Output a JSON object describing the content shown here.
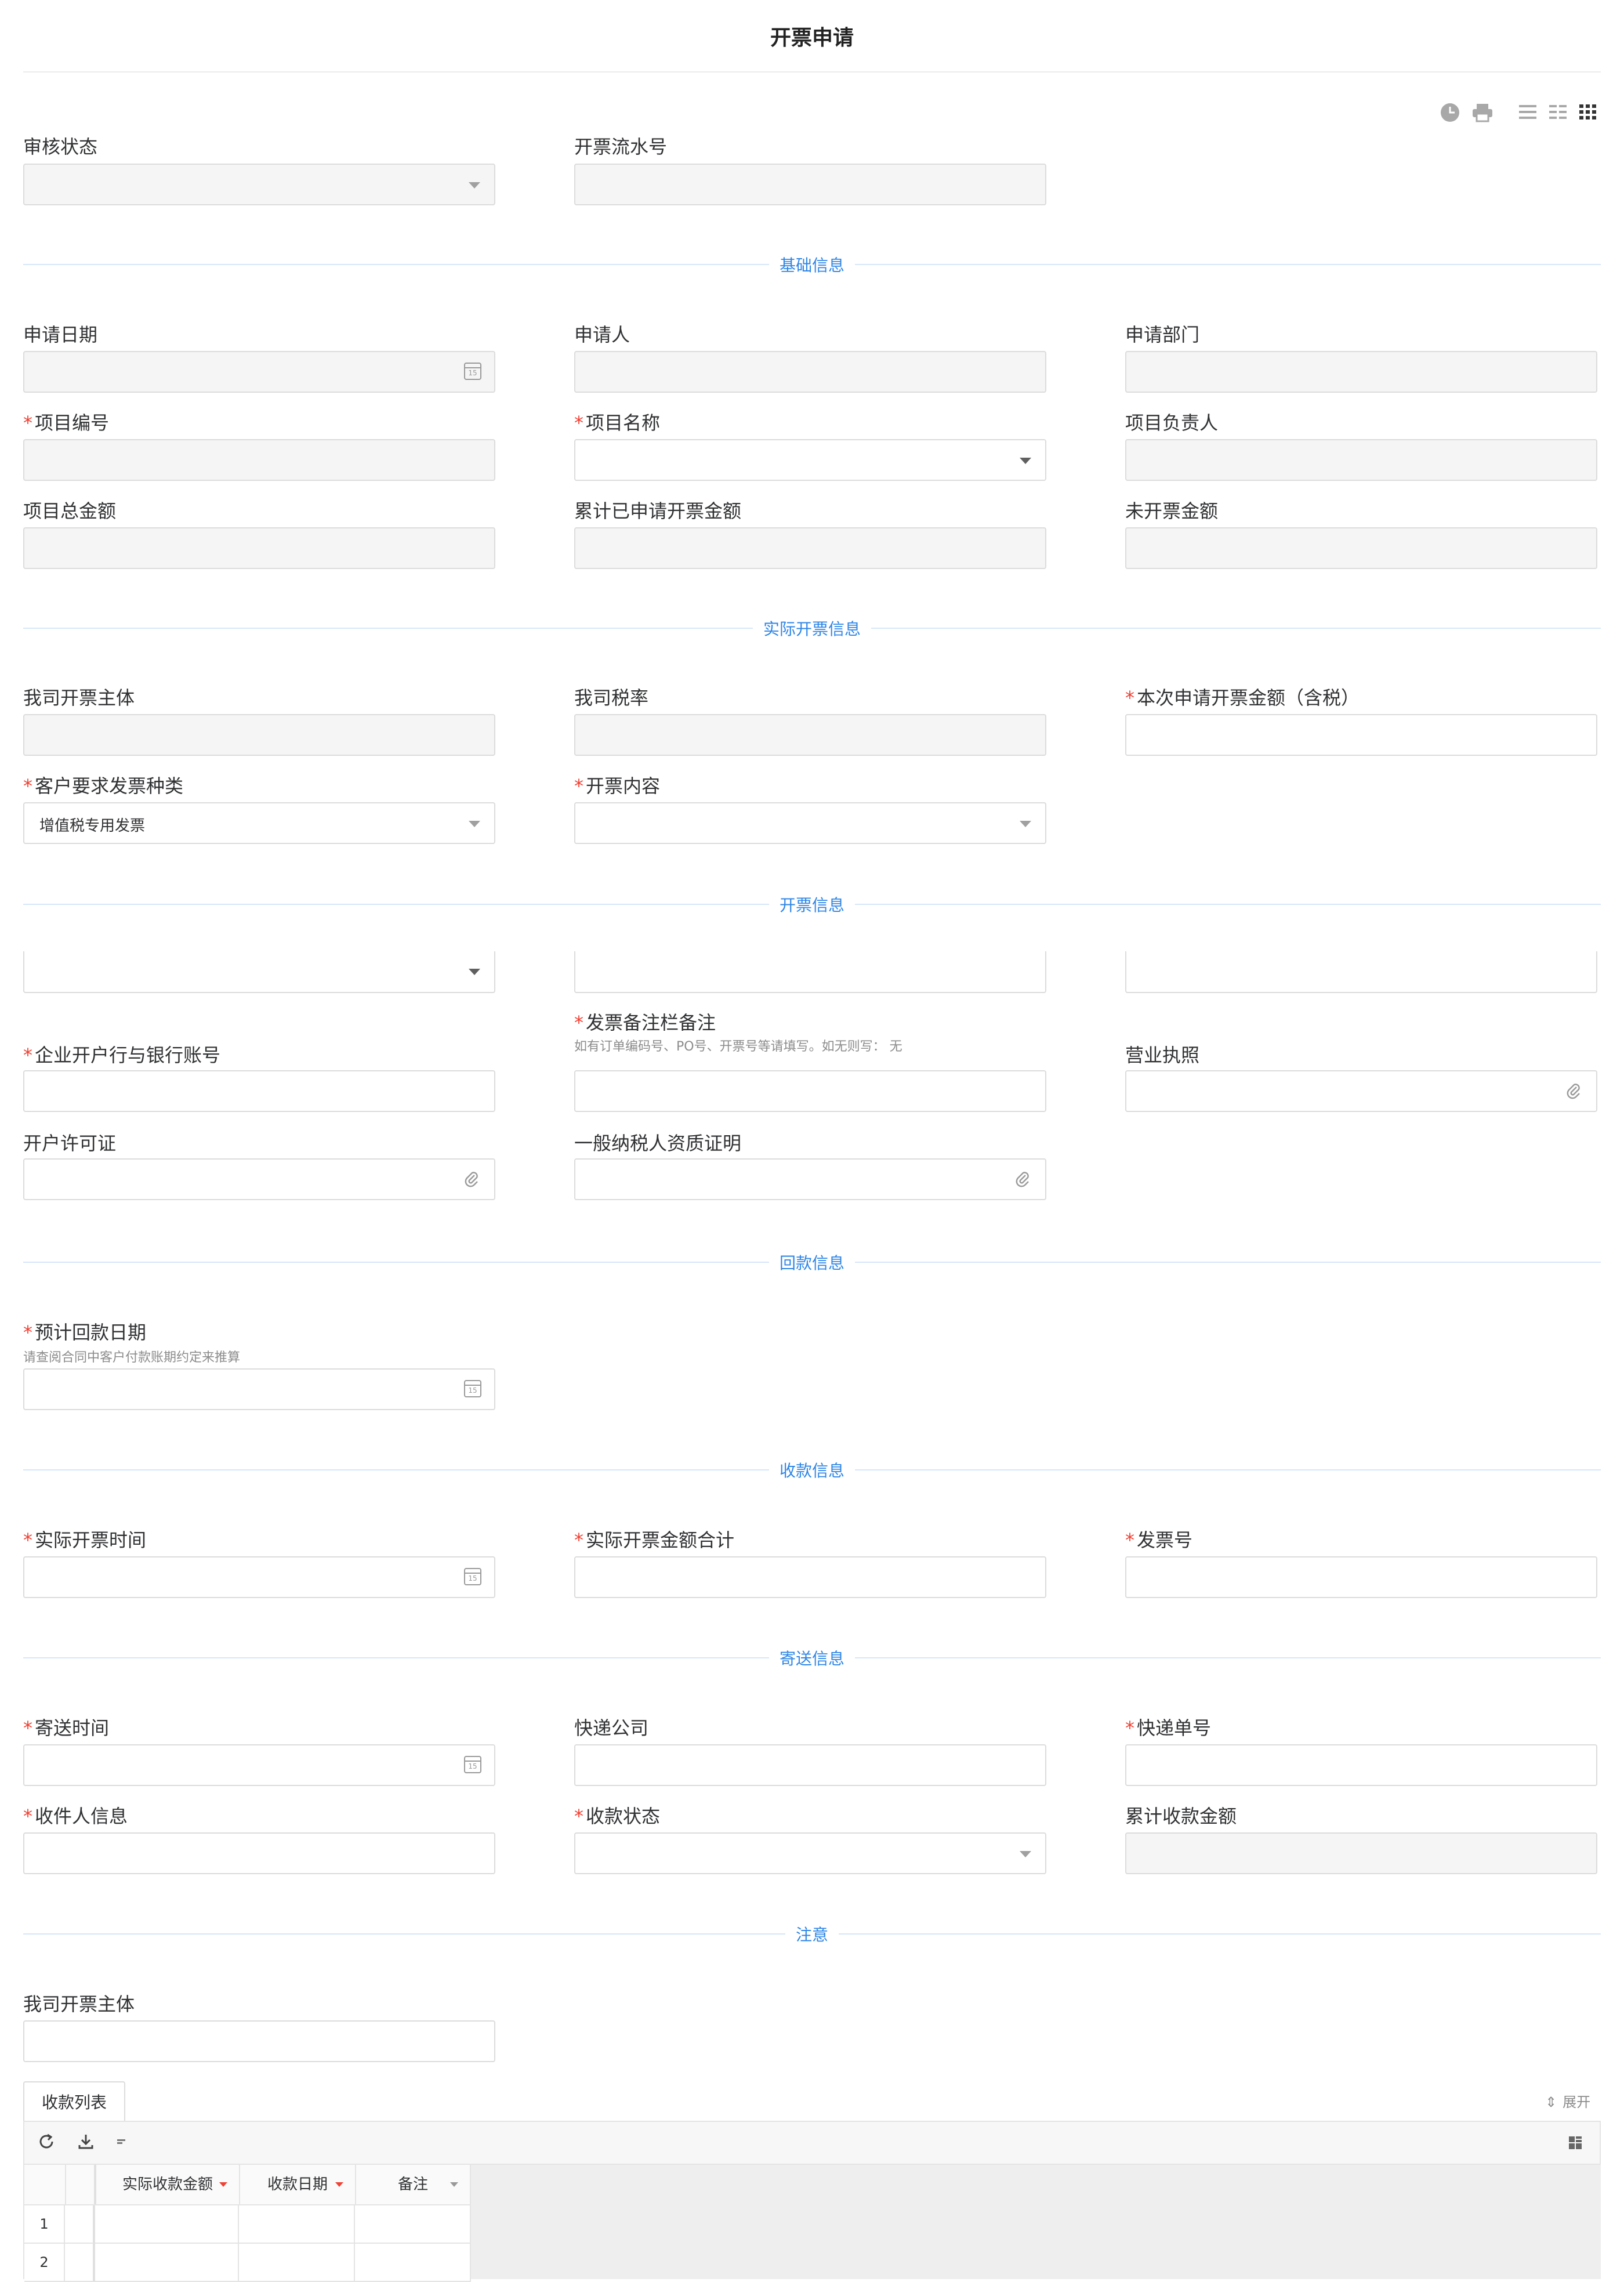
{
  "page": {
    "title": "开票申请"
  },
  "toolbar": {
    "icons": [
      "clock-icon",
      "print-icon",
      "list-view-icon",
      "two-column-icon",
      "three-column-icon"
    ]
  },
  "status_section": {
    "audit_status": {
      "label": "审核状态",
      "value": ""
    },
    "serial_no": {
      "label": "开票流水号",
      "value": ""
    }
  },
  "sections": {
    "basic": "基础信息",
    "actual": "实际开票信息",
    "invoice": "开票信息",
    "payback": "回款信息",
    "receipt": "收款信息",
    "shipping": "寄送信息",
    "notice": "注意"
  },
  "basic": {
    "apply_date": {
      "label": "申请日期"
    },
    "applicant": {
      "label": "申请人"
    },
    "department": {
      "label": "申请部门"
    },
    "project_no": {
      "label": "项目编号",
      "required": true
    },
    "project_name": {
      "label": "项目名称",
      "required": true
    },
    "project_owner": {
      "label": "项目负责人"
    },
    "project_total": {
      "label": "项目总金额"
    },
    "cumulative_amount": {
      "label": "累计已申请开票金额"
    },
    "uninvoiced_amount": {
      "label": "未开票金额"
    }
  },
  "actual": {
    "entity": {
      "label": "我司开票主体"
    },
    "tax_rate": {
      "label": "我司税率"
    },
    "apply_amount": {
      "label": "本次申请开票金额（含税）",
      "required": true
    },
    "invoice_type": {
      "label": "客户要求发票种类",
      "required": true,
      "value": "增值税专用发票"
    },
    "invoice_content": {
      "label": "开票内容",
      "required": true
    }
  },
  "invoice": {
    "bank_account": {
      "label": "企业开户行与银行账号",
      "required": true
    },
    "remark": {
      "label": "发票备注栏备注",
      "required": true,
      "hint": "如有订单编码号、PO号、开票号等请填写。如无则写： 无"
    },
    "license": {
      "label": "营业执照"
    },
    "account_permit": {
      "label": "开户许可证"
    },
    "taxpayer_cert": {
      "label": "一般纳税人资质证明"
    }
  },
  "payback": {
    "expected_date": {
      "label": "预计回款日期",
      "required": true,
      "hint": "请查阅合同中客户付款账期约定来推算"
    }
  },
  "receipt": {
    "actual_time": {
      "label": "实际开票时间",
      "required": true
    },
    "actual_total": {
      "label": "实际开票金额合计",
      "required": true
    },
    "invoice_no": {
      "label": "发票号",
      "required": true
    }
  },
  "shipping": {
    "send_time": {
      "label": "寄送时间",
      "required": true
    },
    "courier": {
      "label": "快递公司"
    },
    "tracking_no": {
      "label": "快递单号",
      "required": true
    },
    "receiver": {
      "label": "收件人信息",
      "required": true
    },
    "payment_status": {
      "label": "收款状态",
      "required": true
    },
    "cumulative_received": {
      "label": "累计收款金额"
    }
  },
  "notice": {
    "entity": {
      "label": "我司开票主体"
    }
  },
  "calendar_day": "15",
  "table": {
    "tab_label": "收款列表",
    "expand_label": "展开",
    "columns": [
      "实际收款金额",
      "收款日期",
      "备注"
    ],
    "rows": [
      "1",
      "2"
    ]
  },
  "colors": {
    "accent": "#2f86e6",
    "required": "#f04134",
    "readonly_bg": "#f5f5f5",
    "border": "#dcdcdc"
  }
}
